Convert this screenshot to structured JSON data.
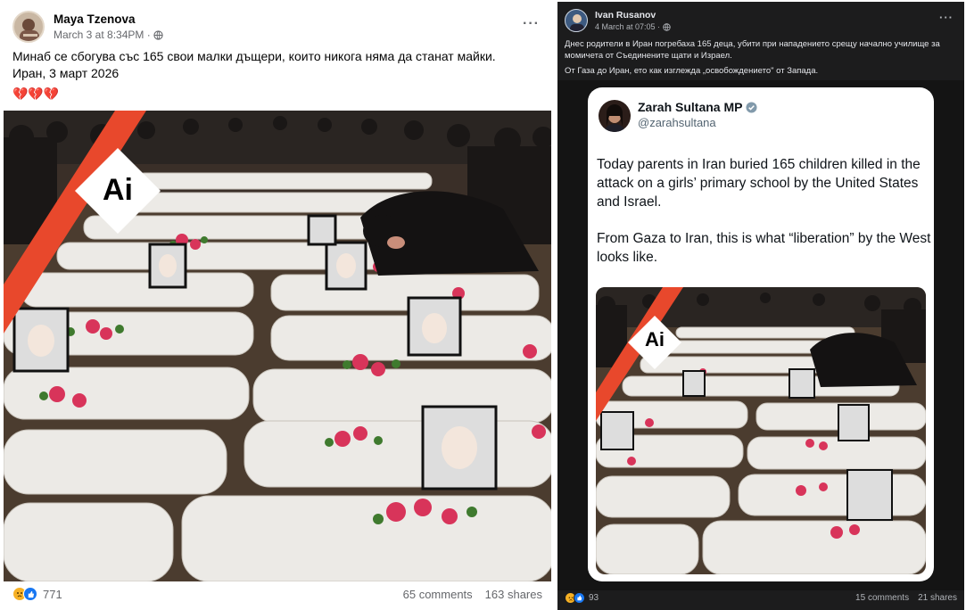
{
  "left_post": {
    "author": "Maya Tzenova",
    "timestamp": "March 3 at 8:34PM ·",
    "more_label": "···",
    "text_lines": [
      "Минаб се сбогува със 165 свои малки дъщери, които никога няма да станат майки.",
      "Иран, 3 март 2026"
    ],
    "emoji_line": "💔💔💔",
    "ai_badge": "Ai",
    "reaction_count": "771",
    "comments": "65 comments",
    "shares": "163 shares"
  },
  "right_post": {
    "author": "Ivan Rusanov",
    "timestamp": "4 March at 07:05 ·",
    "more_label": "···",
    "text_lines": [
      "Днес родители в Иран погребаха 165 деца, убити при нападението срещу начално училище за",
      "момичета от Съединените щати и Израел.",
      "От Газа до Иран, ето как изглежда „освобождението\" от Запада."
    ],
    "reaction_count": "93",
    "comments": "15 comments",
    "shares": "21 shares",
    "tweet": {
      "name": "Zarah Sultana MP",
      "handle": "@zarahsultana",
      "lines": [
        "Today parents in Iran buried 165 children killed in the",
        "attack on a girls’ primary school by the United States",
        "and Israel.",
        "From Gaza to Iran, this is what “liberation” by the West",
        "looks like."
      ],
      "ai_badge": "Ai"
    }
  },
  "colors": {
    "fb_blue": "#1877f2",
    "x_verified": "#1d9bf0",
    "ai_stripe": "#e8482c",
    "dark_bg": "#1c1c1d"
  },
  "icons": [
    "globe-icon",
    "more-icon",
    "like-reaction-icon",
    "sad-reaction-icon",
    "verified-icon",
    "ai-label-icon"
  ]
}
